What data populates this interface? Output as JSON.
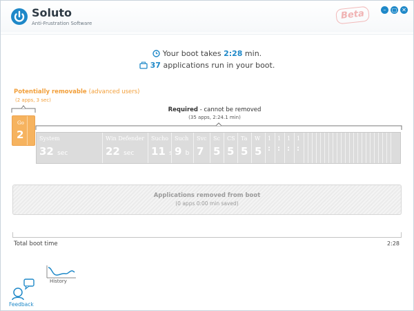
{
  "app": {
    "name": "Soluto",
    "tagline": "Anti-Frustration Software",
    "badge": "Beta"
  },
  "window_controls": {
    "minimize": "–",
    "maximize": "▢",
    "close": "✕"
  },
  "summary": {
    "boot_prefix": "Your boot takes ",
    "boot_time": "2:28",
    "boot_suffix": " min.",
    "apps_count": "37",
    "apps_suffix": " applications run in your boot."
  },
  "removable": {
    "title": "Potentially removable",
    "title_note": "(advanced users)",
    "subtitle": "(2 apps, 3 sec)",
    "segments": [
      {
        "name": "Go",
        "time": "2"
      },
      {
        "name": "",
        "time": ""
      }
    ]
  },
  "required": {
    "title": "Required",
    "title_suffix": " - cannot be removed",
    "subtitle": "(35 apps, 2:24.1 min)",
    "segments": [
      {
        "name": "System",
        "time": "32",
        "unit": "sec"
      },
      {
        "name": "Win Defender",
        "time": "22",
        "unit": "sec"
      },
      {
        "name": "Sucho",
        "time": "11",
        "unit": "s"
      },
      {
        "name": "Such",
        "time": "9",
        "unit": "b"
      },
      {
        "name": "Svc",
        "time": "7",
        "unit": ""
      },
      {
        "name": "Sc",
        "time": "5",
        "unit": ""
      },
      {
        "name": "CS",
        "time": "5",
        "unit": ""
      },
      {
        "name": "Ta",
        "time": "5",
        "unit": ""
      },
      {
        "name": "W",
        "time": "5",
        "unit": ""
      },
      {
        "name": "1",
        "time": ":",
        "unit": ""
      },
      {
        "name": "1",
        "time": ":",
        "unit": ""
      },
      {
        "name": "1",
        "time": ":",
        "unit": ""
      },
      {
        "name": "1",
        "time": ":",
        "unit": ""
      }
    ]
  },
  "removed": {
    "title": "Applications removed from boot",
    "subtitle": "(0 apps 0:00 min saved)"
  },
  "total": {
    "label": "Total boot time",
    "value": "2:28"
  },
  "nav": {
    "history_label": "History",
    "feedback_label": "Feedback"
  },
  "colors": {
    "accent": "#1e88c8",
    "orange": "#f6b35f",
    "gray_bar": "#dcdcdc"
  }
}
